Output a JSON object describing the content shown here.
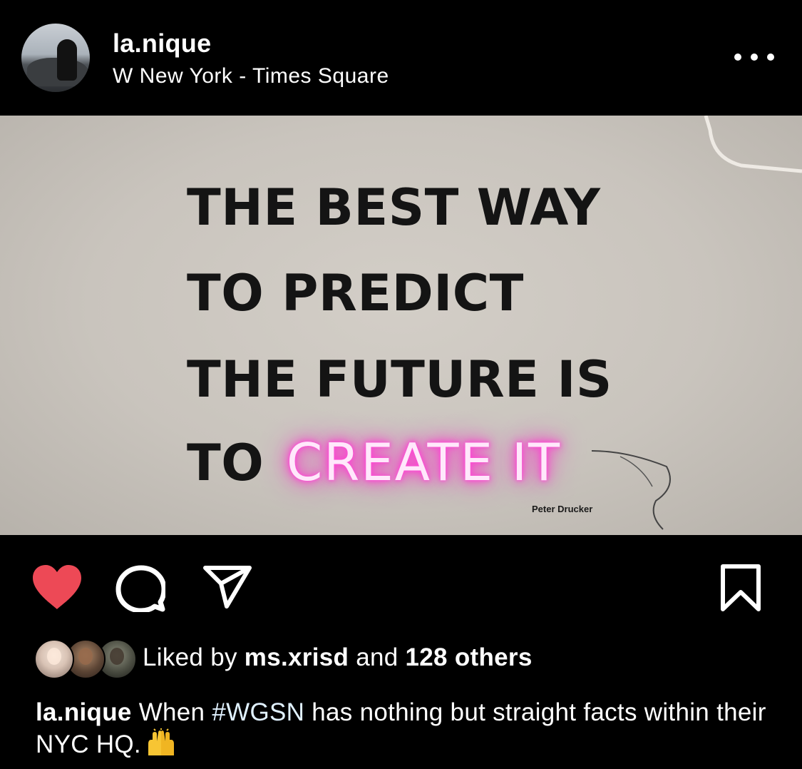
{
  "post": {
    "username": "la.nique",
    "location": "W New York - Times Square",
    "more_icon": "more-horizontal-icon"
  },
  "photo": {
    "quote_lines": [
      "THE BEST WAY",
      "TO PREDICT",
      "THE FUTURE IS",
      "TO"
    ],
    "neon_text": "CREATE IT",
    "attribution": "Peter Drucker",
    "neon_color": "#ff3cd2"
  },
  "actions": {
    "like_icon": "heart-filled-icon",
    "like_color": "#ed4956",
    "comment_icon": "comment-icon",
    "share_icon": "share-paper-plane-icon",
    "save_icon": "bookmark-icon"
  },
  "likes": {
    "prefix": "Liked by",
    "first_user": "ms.xrisd",
    "conjunction": "and",
    "others": "128 others"
  },
  "caption": {
    "user": "la.nique",
    "text_before": "When",
    "hashtag": "#WGSN",
    "text_after": "has nothing but straight facts within their NYC HQ.",
    "emoji": "🙌"
  }
}
